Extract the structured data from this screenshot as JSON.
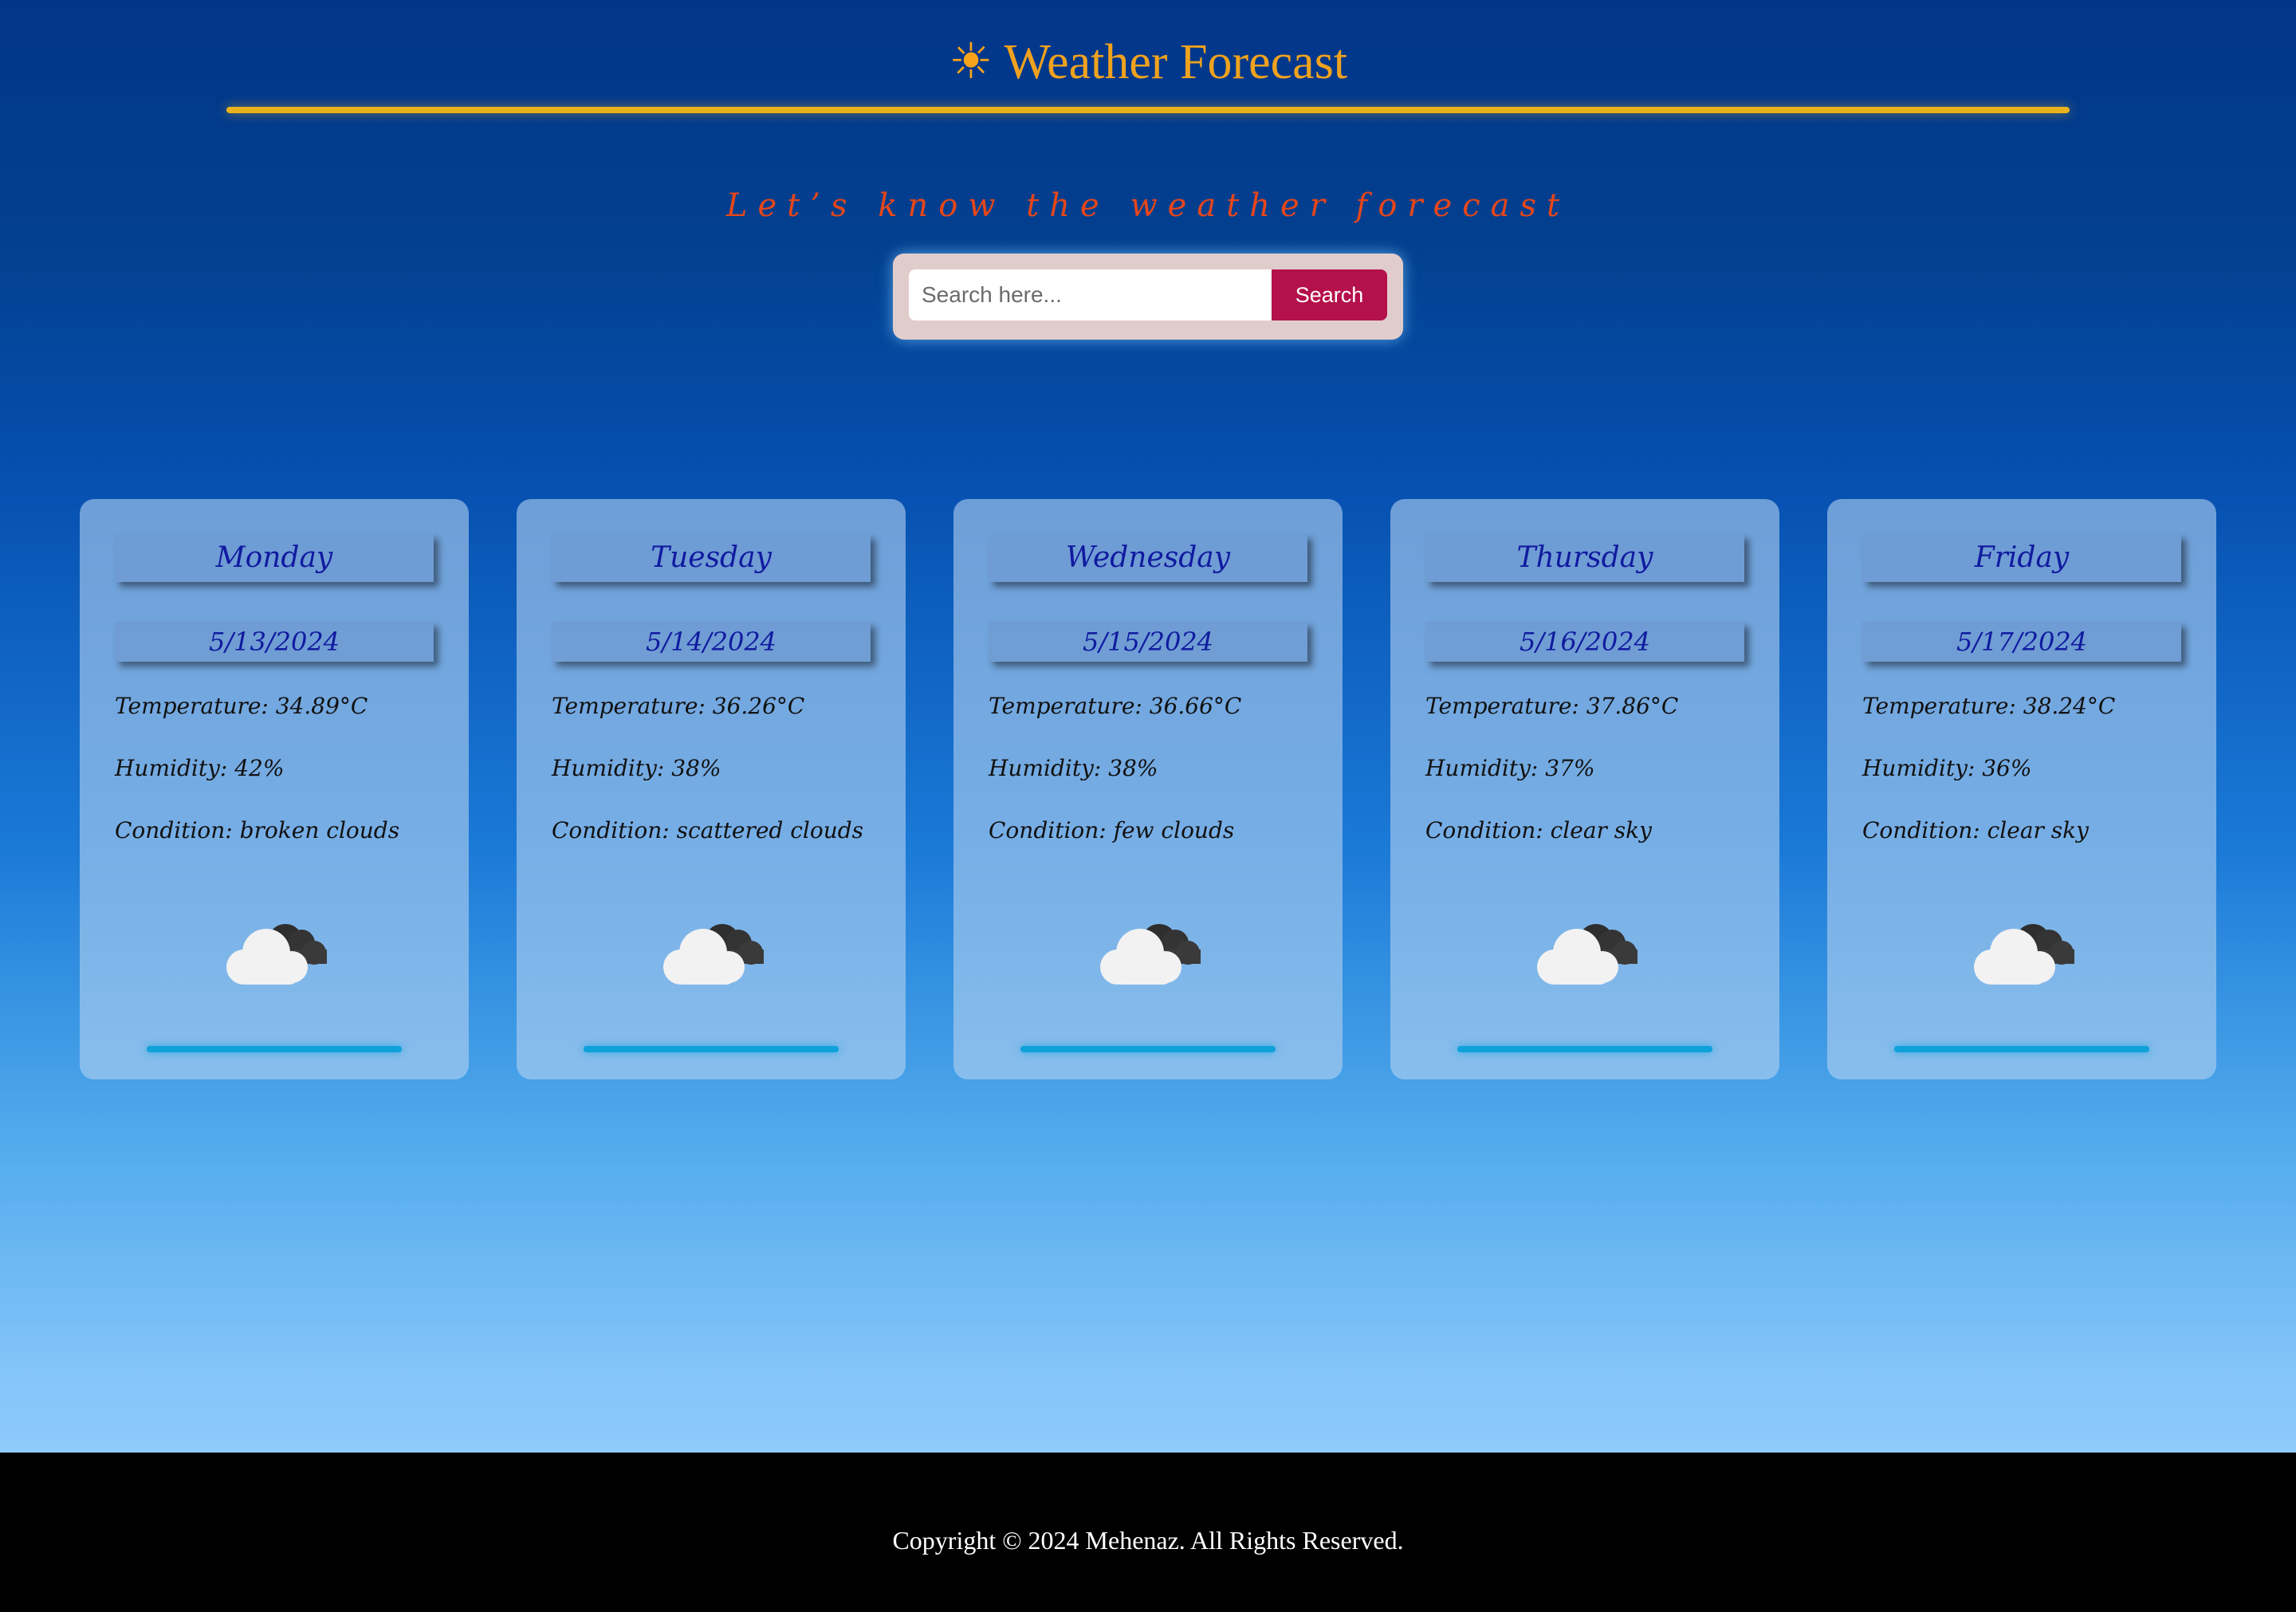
{
  "header": {
    "sun_icon": "☀",
    "title": "Weather Forecast",
    "rule_color": "#e9b21d"
  },
  "tagline": "Let’s know the weather forecast",
  "search": {
    "placeholder": "Search here...",
    "value": "",
    "button_label": "Search",
    "button_color": "#b4104a"
  },
  "forecast": [
    {
      "day": "Monday",
      "date": "5/13/2024",
      "temperature": "Temperature: 34.89°C",
      "humidity": "Humidity: 42%",
      "condition": "Condition: broken clouds",
      "icon": "cloud-icon"
    },
    {
      "day": "Tuesday",
      "date": "5/14/2024",
      "temperature": "Temperature: 36.26°C",
      "humidity": "Humidity: 38%",
      "condition": "Condition: scattered clouds",
      "icon": "cloud-icon"
    },
    {
      "day": "Wednesday",
      "date": "5/15/2024",
      "temperature": "Temperature: 36.66°C",
      "humidity": "Humidity: 38%",
      "condition": "Condition: few clouds",
      "icon": "cloud-icon"
    },
    {
      "day": "Thursday",
      "date": "5/16/2024",
      "temperature": "Temperature: 37.86°C",
      "humidity": "Humidity: 37%",
      "condition": "Condition: clear sky",
      "icon": "cloud-icon"
    },
    {
      "day": "Friday",
      "date": "5/17/2024",
      "temperature": "Temperature: 38.24°C",
      "humidity": "Humidity: 36%",
      "condition": "Condition: clear sky",
      "icon": "cloud-icon"
    }
  ],
  "footer": {
    "text": "Copyright © 2024 Mehenaz. All Rights Reserved."
  }
}
